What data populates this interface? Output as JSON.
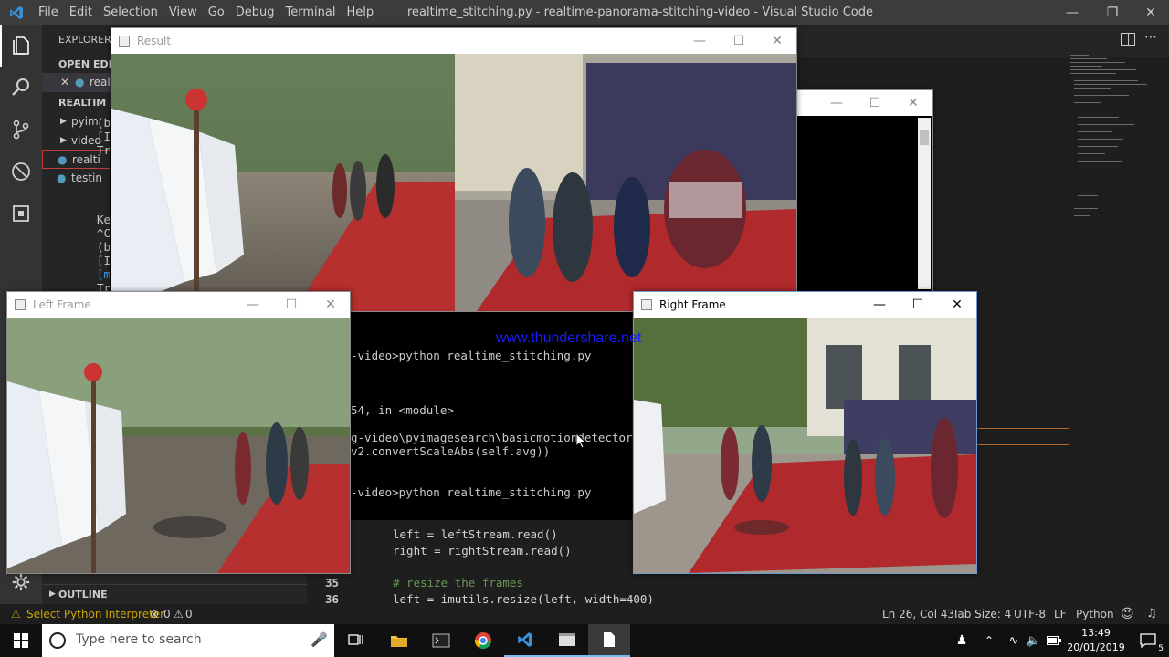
{
  "window": {
    "title": "realtime_stitching.py - realtime-panorama-stitching-video - Visual Studio Code",
    "menu": [
      "File",
      "Edit",
      "Selection",
      "View",
      "Go",
      "Debug",
      "Terminal",
      "Help"
    ]
  },
  "sidebar": {
    "header": "EXPLORER",
    "open_editors": "OPEN EDITO",
    "open_editor_file": "realt",
    "project": "REALTIM",
    "items": [
      "pyim",
      "video",
      "realti",
      "testin"
    ],
    "outline": "OUTLINE"
  },
  "terminal": {
    "lines": [
      "-video>python realtime_stitching.py",
      "54, in <module>",
      "g-video\\pyimagesearch\\basicmotiondetector",
      "v2.convertScaleAbs(self.avg))",
      "-video>python realtime_stitching.py"
    ],
    "left_fragments": [
      "(b",
      "[I",
      "Tr",
      "Ke",
      "^C",
      "(b",
      "[I",
      "[m",
      "Tr"
    ]
  },
  "editor": {
    "lines": [
      {
        "num": "",
        "text": "left = leftStream.read()"
      },
      {
        "num": "",
        "text": "right = rightStream.read()"
      },
      {
        "num": "35",
        "text": "# resize the frames"
      },
      {
        "num": "36",
        "text": "left = imutils.resize(left, width=400)"
      }
    ]
  },
  "windows": {
    "result": "Result",
    "left": "Left Frame",
    "right": "Right Frame"
  },
  "watermark": "www.thundershare.net",
  "statusbar": {
    "interpreter": "Select Python Interpreter",
    "errors": "0",
    "warnings": "0",
    "position": "Ln 26, Col 43",
    "tab_size": "Tab Size: 4",
    "encoding": "UTF-8",
    "eol": "LF",
    "language": "Python"
  },
  "taskbar": {
    "search_placeholder": "Type here to search",
    "time": "13:49",
    "date": "20/01/2019",
    "notifications": "5"
  },
  "colors": {
    "titlebar": "#3c3c3c",
    "statusbar": "#1e1e1e",
    "accent_blue": "#0078d7",
    "warning": "#cca700"
  }
}
